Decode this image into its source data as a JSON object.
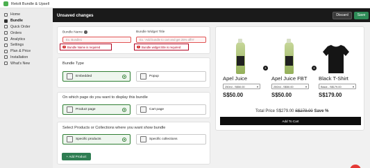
{
  "app": {
    "title": "Retolt Bundle & Upsell"
  },
  "sidebar": {
    "items": [
      {
        "label": "Home",
        "icon": "home-icon",
        "active": false
      },
      {
        "label": "Bundle",
        "icon": "bundle-icon",
        "active": true
      },
      {
        "label": "Quick Order",
        "icon": "cart-icon",
        "active": false
      },
      {
        "label": "Orders",
        "icon": "orders-icon",
        "active": false
      },
      {
        "label": "Analytics",
        "icon": "chart-icon",
        "active": false
      },
      {
        "label": "Settings",
        "icon": "gear-icon",
        "active": false
      },
      {
        "label": "Plan & Price",
        "icon": "price-icon",
        "active": false
      },
      {
        "label": "Installation",
        "icon": "install-icon",
        "active": false
      },
      {
        "label": "What's New",
        "icon": "news-icon",
        "active": false
      }
    ]
  },
  "savebar": {
    "message": "Unsaved changes",
    "discard_label": "Discard",
    "save_label": "Save"
  },
  "form": {
    "bundle_name": {
      "label": "Bundle Name",
      "placeholder": "Ex. Bundle1",
      "value": "",
      "error": "Bundle Name is required"
    },
    "widget_title": {
      "label": "Bundle Widget Title",
      "placeholder": "Ex. 'Add bundle to cart and get 25% off!!!'",
      "value": "",
      "error": "Bundle widget title is required"
    },
    "bundle_type": {
      "title": "Bundle Type",
      "options": [
        {
          "label": "Embedded",
          "selected": true
        },
        {
          "label": "Popup",
          "selected": false
        }
      ]
    },
    "page": {
      "title": "On which page do you want to display this bundle",
      "options": [
        {
          "label": "Product page",
          "selected": true
        },
        {
          "label": "Cart page",
          "selected": false
        }
      ]
    },
    "products": {
      "title": "Select Products or Collections where you want show bundle",
      "options": [
        {
          "label": "Specific products",
          "selected": true
        },
        {
          "label": "Specific collections",
          "selected": false
        }
      ]
    },
    "add_product_label": "+ Add Product"
  },
  "preview": {
    "products": [
      {
        "name": "Apel Juice",
        "variant": "250ml - S$50.00",
        "price": "S$50.00",
        "image": "juice-bottle"
      },
      {
        "name": "Apel Juice FBT",
        "variant": "250ml - S$50.00",
        "price": "S$50.00",
        "image": "juice-bottle"
      },
      {
        "name": "Black T-Shirt",
        "variant": "Black - S$179.00",
        "price": "S$179.00",
        "image": "black-tshirt"
      }
    ],
    "total_label": "Total Price",
    "total_price": "S$279.00",
    "total_original": "S$279.00",
    "total_save": "Save %",
    "cart_label": "Add To Cart"
  },
  "colors": {
    "accent": "#2e7d32",
    "error": "#b00020",
    "dark": "#1a1a1a"
  }
}
